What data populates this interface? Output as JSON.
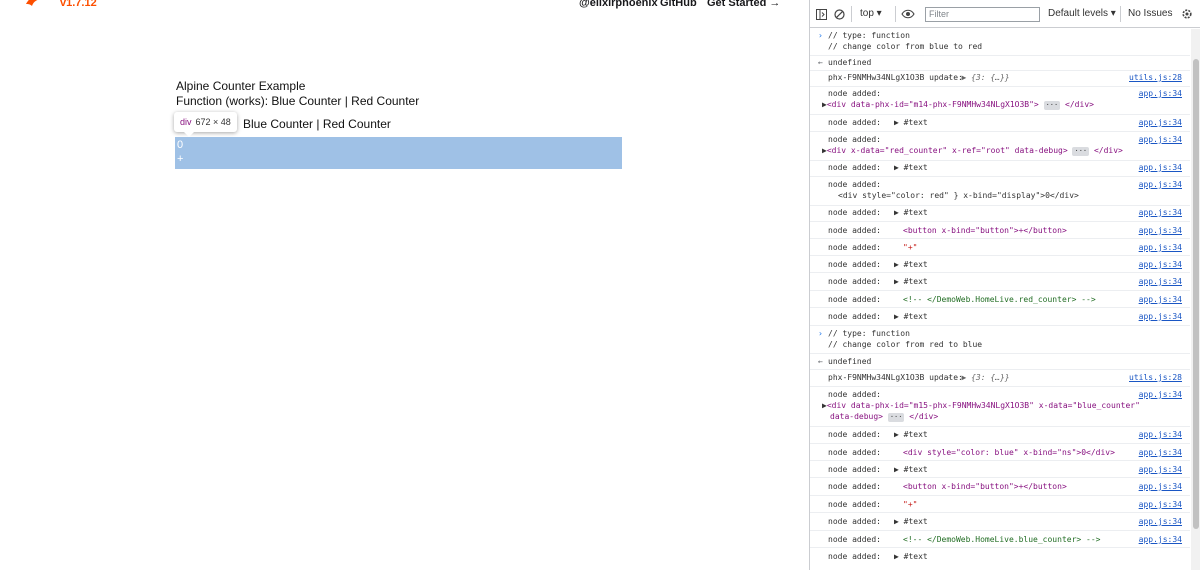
{
  "page": {
    "version": "v1.7.12",
    "nav": {
      "twitter": "@elixirphoenix",
      "github": "GitHub",
      "get_started": "Get Started →"
    },
    "title": "Alpine Counter Example",
    "function_line": "Function (works): Blue Counter | Red Counter",
    "counter_line": "Blue Counter | Red Counter",
    "tooltip_tag": "div",
    "tooltip_dims": "672 × 48",
    "counter_value": "0",
    "plus": "+"
  },
  "devtools": {
    "context": "top",
    "filter_placeholder": "Filter",
    "levels": "Default levels",
    "issues": "No Issues",
    "entries": [
      {
        "kind": "input",
        "line1": "// type: function",
        "line2": "// change color from blue to red"
      },
      {
        "kind": "return",
        "text": "undefined"
      },
      {
        "kind": "log",
        "label": "phx-F9NMHw34NLgX1O3B update:",
        "value": "-  ▶ {3: {…}}",
        "src": "utils.js:28"
      },
      {
        "kind": "log2",
        "label": "node added:",
        "value": "<div data-phx-id=\"m14-phx-F9NMHw34NLgX1O3B\">",
        "src": "app.js:34"
      },
      {
        "kind": "log",
        "label": "node added:",
        "value": "▶ #text",
        "src": "app.js:34"
      },
      {
        "kind": "log2",
        "label": "node added:",
        "value": "<div x-data=\"red_counter\" x-ref=\"root\" data-debug>",
        "src": "app.js:34"
      },
      {
        "kind": "log",
        "label": "node added:",
        "value": "▶ #text",
        "src": "app.js:34"
      },
      {
        "kind": "log2",
        "label": "node added:",
        "value": "<div style=\"color: red\" } x-bind=\"display\">0</div>",
        "src": "app.js:34"
      },
      {
        "kind": "log",
        "label": "node added:",
        "value": "▶ #text",
        "src": "app.js:34"
      },
      {
        "kind": "log",
        "label": "node added:",
        "value": "<button x-bind=\"button\">+</button>",
        "src": "app.js:34"
      },
      {
        "kind": "log",
        "label": "node added:",
        "value": "\"+\"",
        "src": "app.js:34"
      },
      {
        "kind": "log",
        "label": "node added:",
        "value": "▶ #text",
        "src": "app.js:34"
      },
      {
        "kind": "log",
        "label": "node added:",
        "value": "▶ #text",
        "src": "app.js:34"
      },
      {
        "kind": "log",
        "label": "node added:",
        "value": "<!-- </DemoWeb.HomeLive.red_counter> -->",
        "src": "app.js:34"
      },
      {
        "kind": "log",
        "label": "node added:",
        "value": "▶ #text",
        "src": "app.js:34"
      },
      {
        "kind": "input",
        "line1": "// type: function",
        "line2": "// change color from red to blue"
      },
      {
        "kind": "return",
        "text": "undefined"
      },
      {
        "kind": "log",
        "label": "phx-F9NMHw34NLgX1O3B update:",
        "value": "-  ▶ {3: {…}}",
        "src": "utils.js:28"
      },
      {
        "kind": "log3",
        "label": "node added:",
        "value": "<div data-phx-id=\"m15-phx-F9NMHw34NLgX1O3B\" x-data=\"blue_counter\"",
        "value2": "data-debug>",
        "src": "app.js:34"
      },
      {
        "kind": "log",
        "label": "node added:",
        "value": "▶ #text",
        "src": "app.js:34"
      },
      {
        "kind": "log",
        "label": "node added:",
        "value": "<div style=\"color: blue\" x-bind=\"ns\">0</div>",
        "src": "app.js:34"
      },
      {
        "kind": "log",
        "label": "node added:",
        "value": "▶ #text",
        "src": "app.js:34"
      },
      {
        "kind": "log",
        "label": "node added:",
        "value": "<button x-bind=\"button\">+</button>",
        "src": "app.js:34"
      },
      {
        "kind": "log",
        "label": "node added:",
        "value": "\"+\"",
        "src": "app.js:34"
      },
      {
        "kind": "log",
        "label": "node added:",
        "value": "▶ #text",
        "src": "app.js:34"
      },
      {
        "kind": "log",
        "label": "node added:",
        "value": "<!-- </DemoWeb.HomeLive.blue_counter> -->",
        "src": "app.js:34"
      },
      {
        "kind": "log",
        "label": "node added:",
        "value": "▶ #text",
        "src": "app.js:34"
      }
    ]
  },
  "colors": {
    "accent_orange": "#fd4f00",
    "highlight_blue": "#9fc1e6",
    "link_blue": "#1a56c4"
  }
}
